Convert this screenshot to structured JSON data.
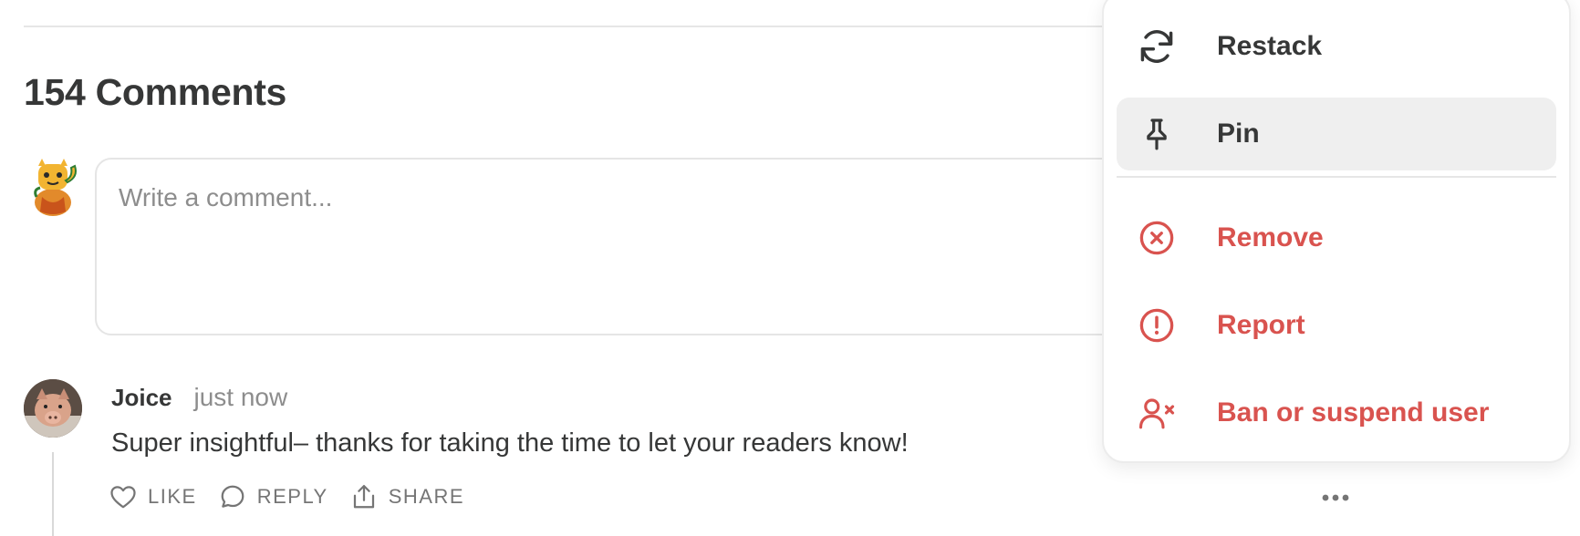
{
  "comments": {
    "heading": "154 Comments",
    "composer": {
      "placeholder": "Write a comment..."
    }
  },
  "comment": {
    "author": "Joice",
    "time": "just now",
    "body": "Super insightful– thanks for taking the time to let your readers know!",
    "actions": {
      "like": "LIKE",
      "reply": "REPLY",
      "share": "SHARE"
    },
    "more_icon": "ellipsis-icon"
  },
  "menu": {
    "items": [
      {
        "label": "Restack",
        "icon": "restack-icon",
        "style": "normal"
      },
      {
        "label": "Pin",
        "icon": "pin-icon",
        "style": "highlighted"
      },
      {
        "label": "Remove",
        "icon": "remove-icon",
        "style": "danger"
      },
      {
        "label": "Report",
        "icon": "report-icon",
        "style": "danger"
      },
      {
        "label": "Ban or suspend user",
        "icon": "ban-user-icon",
        "style": "danger"
      }
    ]
  },
  "colors": {
    "text": "#363737",
    "muted": "#8d8d8d",
    "danger": "#d9534f",
    "highlight": "#efefef"
  }
}
